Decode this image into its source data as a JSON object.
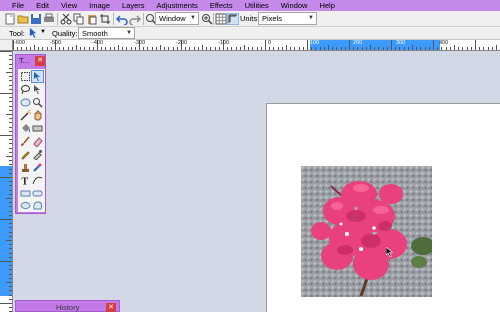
{
  "menu": [
    "File",
    "Edit",
    "View",
    "Image",
    "Layers",
    "Adjustments",
    "Effects",
    "Utilities",
    "Window",
    "Help"
  ],
  "toolbar": {
    "zoom_value": "Window",
    "units_label": "Units:",
    "units_value": "Pixels"
  },
  "toolbar2": {
    "tool_label": "Tool:",
    "quality_label": "Quality:",
    "quality_value": "Smooth"
  },
  "ruler": {
    "h_labels": [
      "-600",
      "-500",
      "-400",
      "-300",
      "-200",
      "-100",
      "0",
      "100",
      "200",
      "300",
      "400"
    ]
  },
  "tools_panel": {
    "title": "T...",
    "close": "✕"
  },
  "history_panel": {
    "title": "History",
    "close": "✕"
  },
  "colors": {
    "accent": "#c589ea",
    "panel": "#c37be8",
    "selection": "#3d9bff",
    "workspace": "#d3d8e6",
    "close": "#d43f3f"
  }
}
